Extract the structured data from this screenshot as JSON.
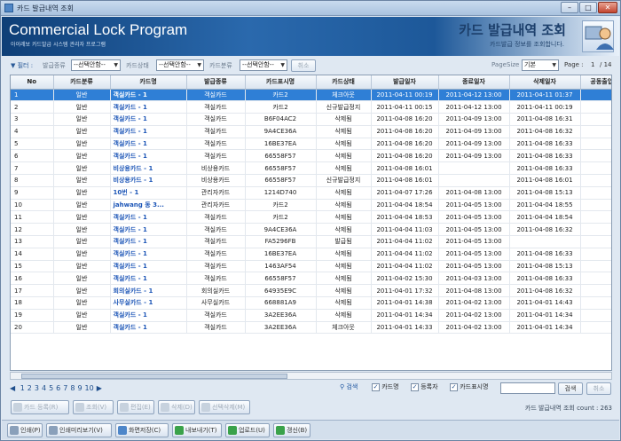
{
  "window": {
    "title": "카드 발급내역 조회"
  },
  "banner": {
    "app_title": "Commercial Lock Program",
    "app_subtitle": "아이레보 카드발급 시스템 관리자 프로그램",
    "screen_title": "카드 발급내역 조회",
    "screen_subtitle": "카드발급 정보를 조회합니다."
  },
  "filter": {
    "label": "필터 :",
    "issue_type_label": "발급종류",
    "issue_type_value": "--선택안함--",
    "card_state_label": "카드상태",
    "card_state_value": "--선택안함--",
    "card_class_label": "카드분류",
    "card_class_value": "--선택안함--",
    "cancel_label": "취소",
    "pagesize_label": "PageSize",
    "pagesize_value": "기본",
    "page_label": "Page :",
    "page_current": "1",
    "page_total": "/ 14"
  },
  "table": {
    "headers": [
      "No",
      "카드분류",
      "카드명",
      "발급종류",
      "카드표시명",
      "카드상태",
      "발급일자",
      "종료일자",
      "삭제일자",
      "공동출입문"
    ],
    "rows": [
      [
        "1",
        "일반",
        "객실카드 - 1",
        "객실카드",
        "카드2",
        "체크아웃",
        "2011-04-11 00:19",
        "2011-04-12 13:00",
        "2011-04-11 01:37",
        ""
      ],
      [
        "2",
        "일반",
        "객실카드 - 1",
        "객실카드",
        "카드2",
        "신규발급정지",
        "2011-04-11 00:15",
        "2011-04-12 13:00",
        "2011-04-11 00:19",
        ""
      ],
      [
        "3",
        "일반",
        "객실카드 - 1",
        "객실카드",
        "B6F04AC2",
        "삭제됨",
        "2011-04-08 16:20",
        "2011-04-09 13:00",
        "2011-04-08 16:31",
        ""
      ],
      [
        "4",
        "일반",
        "객실카드 - 1",
        "객실카드",
        "9A4CE36A",
        "삭제됨",
        "2011-04-08 16:20",
        "2011-04-09 13:00",
        "2011-04-08 16:32",
        ""
      ],
      [
        "5",
        "일반",
        "객실카드 - 1",
        "객실카드",
        "16BE37EA",
        "삭제됨",
        "2011-04-08 16:20",
        "2011-04-09 13:00",
        "2011-04-08 16:33",
        ""
      ],
      [
        "6",
        "일반",
        "객실카드 - 1",
        "객실카드",
        "66558F57",
        "삭제됨",
        "2011-04-08 16:20",
        "2011-04-09 13:00",
        "2011-04-08 16:33",
        ""
      ],
      [
        "7",
        "일반",
        "비상용카드 - 1",
        "비상용카드",
        "66558F57",
        "삭제됨",
        "2011-04-08 16:01",
        "",
        "2011-04-08 16:33",
        ""
      ],
      [
        "8",
        "일반",
        "비상용카드 - 1",
        "비상용카드",
        "66558F57",
        "신규발급정지",
        "2011-04-08 16:01",
        "",
        "2011-04-08 16:01",
        ""
      ],
      [
        "9",
        "일반",
        "10번 - 1",
        "관리자카드",
        "1214D740",
        "삭제됨",
        "2011-04-07 17:26",
        "2011-04-08 13:00",
        "2011-04-08 15:13",
        ""
      ],
      [
        "10",
        "일반",
        "jahwang 동 3...",
        "관리자카드",
        "카드2",
        "삭제됨",
        "2011-04-04 18:54",
        "2011-04-05 13:00",
        "2011-04-04 18:55",
        ""
      ],
      [
        "11",
        "일반",
        "객실카드 - 1",
        "객실카드",
        "카드2",
        "삭제됨",
        "2011-04-04 18:53",
        "2011-04-05 13:00",
        "2011-04-04 18:54",
        ""
      ],
      [
        "12",
        "일반",
        "객실카드 - 1",
        "객실카드",
        "9A4CE36A",
        "삭제됨",
        "2011-04-04 11:03",
        "2011-04-05 13:00",
        "2011-04-08 16:32",
        ""
      ],
      [
        "13",
        "일반",
        "객실카드 - 1",
        "객실카드",
        "FA5296FB",
        "발급됨",
        "2011-04-04 11:02",
        "2011-04-05 13:00",
        "",
        ""
      ],
      [
        "14",
        "일반",
        "객실카드 - 1",
        "객실카드",
        "16BE37EA",
        "삭제됨",
        "2011-04-04 11:02",
        "2011-04-05 13:00",
        "2011-04-08 16:33",
        ""
      ],
      [
        "15",
        "일반",
        "객실카드 - 1",
        "객실카드",
        "1463AF54",
        "삭제됨",
        "2011-04-04 11:02",
        "2011-04-05 13:00",
        "2011-04-08 15:13",
        ""
      ],
      [
        "16",
        "일반",
        "객실카드 - 1",
        "객실카드",
        "66558F57",
        "삭제됨",
        "2011-04-02 15:30",
        "2011-04-03 13:00",
        "2011-04-08 16:33",
        ""
      ],
      [
        "17",
        "일반",
        "회의실카드 - 1",
        "회의실카드",
        "64935E9C",
        "삭제됨",
        "2011-04-01 17:32",
        "2011-04-08 13:00",
        "2011-04-08 16:32",
        ""
      ],
      [
        "18",
        "일반",
        "사무실카드 - 1",
        "사무실카드",
        "668881A9",
        "삭제됨",
        "2011-04-01 14:38",
        "2011-04-02 13:00",
        "2011-04-01 14:43",
        ""
      ],
      [
        "19",
        "일반",
        "객실카드 - 1",
        "객실카드",
        "3A2EE36A",
        "삭제됨",
        "2011-04-01 14:34",
        "2011-04-02 13:00",
        "2011-04-01 14:34",
        ""
      ],
      [
        "20",
        "일반",
        "객실카드 - 1",
        "객실카드",
        "3A2EE36A",
        "체크아웃",
        "2011-04-01 14:33",
        "2011-04-02 13:00",
        "2011-04-01 14:34",
        ""
      ]
    ]
  },
  "pager": {
    "pages": [
      "1",
      "2",
      "3",
      "4",
      "5",
      "6",
      "7",
      "8",
      "9",
      "10"
    ]
  },
  "search": {
    "label": "검색",
    "cb_name": "카드명",
    "cb_registrant": "등록자",
    "cb_display": "카드표시명",
    "search_button": "검색",
    "cancel_button": "취소"
  },
  "actions": {
    "register": "카드 등록(R)",
    "view": "조회(V)",
    "edit": "편집(E)",
    "delete": "삭제(D)",
    "delete_selected": "선택삭제(M)",
    "count_text": "카드 발급내역 조회 count : 263"
  },
  "bottom": {
    "print": "인쇄(P)",
    "print_preview": "인쇄미리보기(V)",
    "save_screen": "화면저장(C)",
    "export": "내보내기(T)",
    "upload": "업로드(U)",
    "refresh": "갱신(B)"
  }
}
